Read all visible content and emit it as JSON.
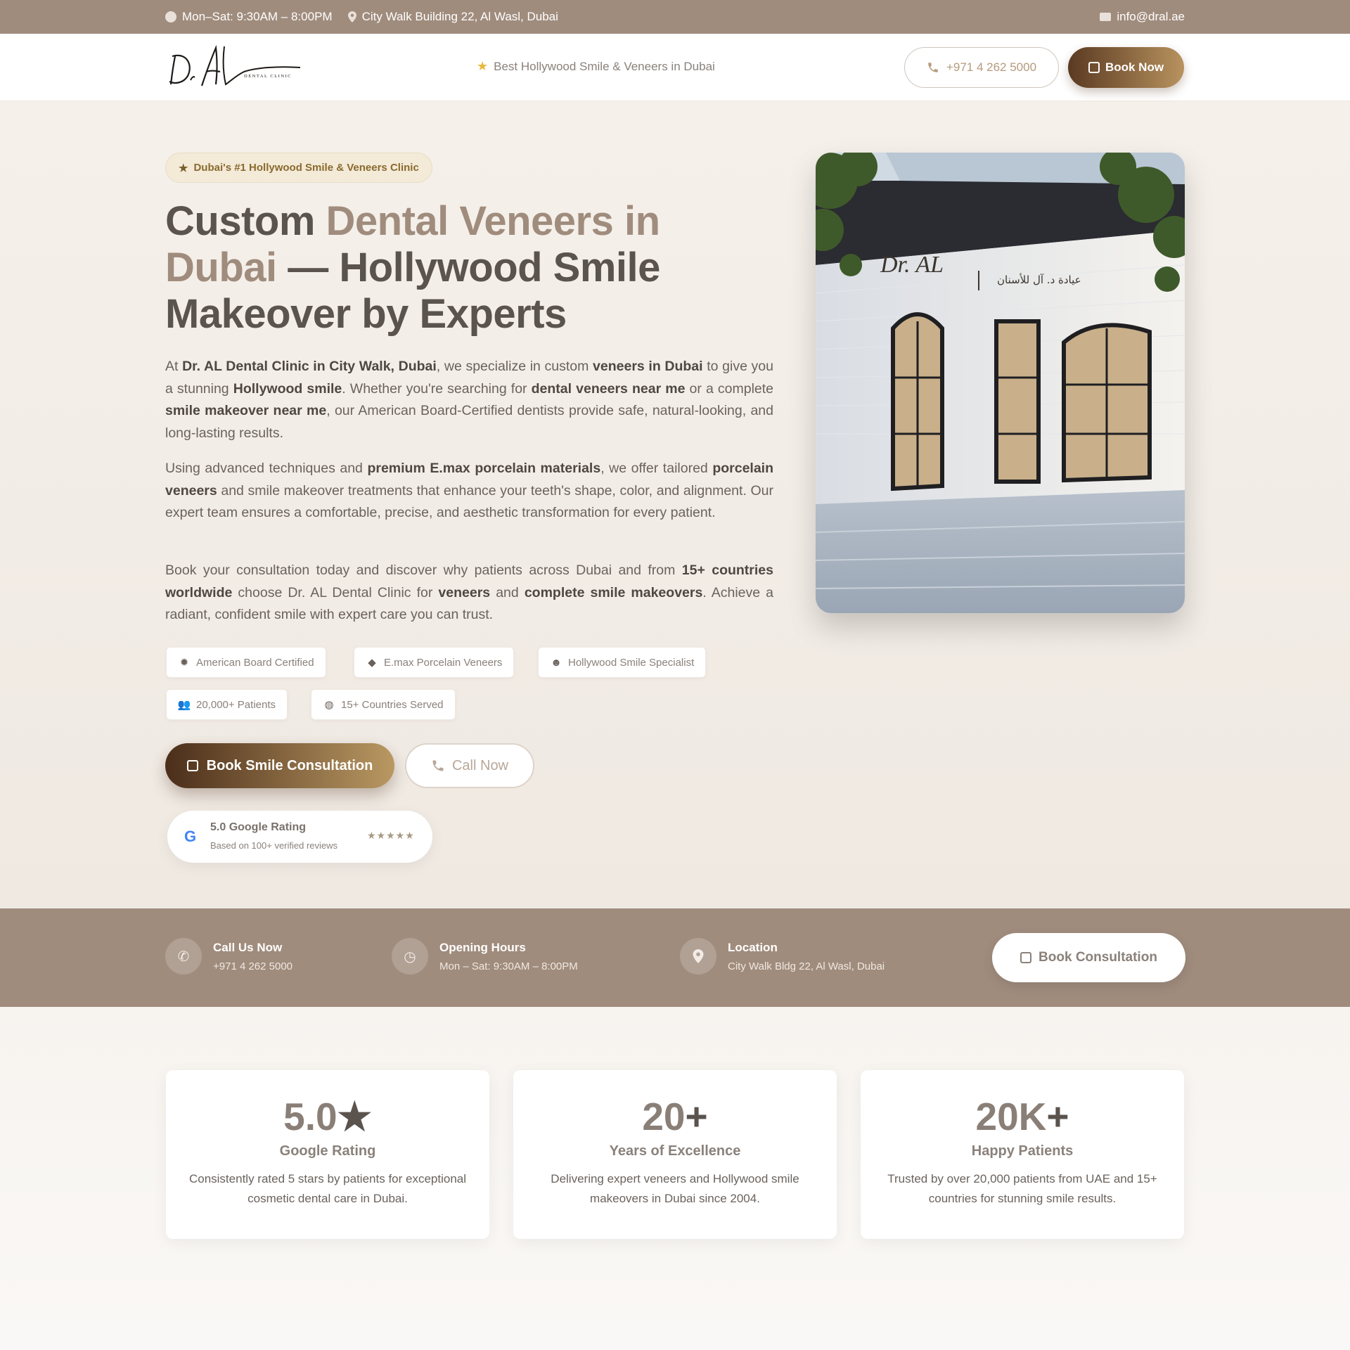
{
  "topbar": {
    "hours": "Mon–Sat: 9:30AM – 8:00PM",
    "address": "City Walk Building 22, Al Wasl, Dubai",
    "email": "info@dral.ae"
  },
  "header": {
    "logo_text": "Dr. AL",
    "logo_sub": "DENTAL CLINIC",
    "tagline": "Best Hollywood Smile & Veneers in Dubai",
    "phone": "+971 4 262 5000",
    "book_label": "Book Now"
  },
  "hero": {
    "badge": "Dubai's #1 Hollywood Smile & Veneers Clinic",
    "title_part1": "Custom ",
    "title_accent1": "Dental Veneers in Dubai",
    "title_part2": " — Hollywood Smile Makeover by Experts",
    "paragraphs": [
      [
        {
          "t": "At "
        },
        {
          "t": "Dr. AL Dental Clinic in City Walk, Dubai",
          "b": true
        },
        {
          "t": ", we specialize in custom "
        },
        {
          "t": "veneers in Dubai",
          "b": true
        },
        {
          "t": " to give you a stunning "
        },
        {
          "t": "Hollywood smile",
          "b": true
        },
        {
          "t": ". Whether you're searching for "
        },
        {
          "t": "dental veneers near me",
          "b": true
        },
        {
          "t": " or a complete "
        },
        {
          "t": "smile makeover near me",
          "b": true
        },
        {
          "t": ", our American Board-Certified dentists provide safe, natural-looking, and long-lasting results."
        }
      ],
      [
        {
          "t": "Using advanced techniques and "
        },
        {
          "t": "premium E.max porcelain materials",
          "b": true
        },
        {
          "t": ", we offer tailored "
        },
        {
          "t": "porcelain veneers",
          "b": true
        },
        {
          "t": " and smile makeover treatments that enhance your teeth's shape, color, and alignment. Our expert team ensures a comfortable, precise, and aesthetic transformation for every patient."
        }
      ],
      [
        {
          "t": "Book your consultation today and discover why patients across Dubai and from "
        },
        {
          "t": "15+ countries worldwide",
          "b": true
        },
        {
          "t": " choose Dr. AL Dental Clinic for "
        },
        {
          "t": "veneers",
          "b": true
        },
        {
          "t": " and "
        },
        {
          "t": "complete smile makeovers",
          "b": true
        },
        {
          "t": ". Achieve a radiant, confident smile with expert care you can trust."
        }
      ]
    ],
    "chips": [
      {
        "label": "American Board Certified",
        "icon": "certificate-icon"
      },
      {
        "label": "E.max Porcelain Veneers",
        "icon": "gem-icon"
      },
      {
        "label": "Hollywood Smile Specialist",
        "icon": "smile-icon"
      },
      {
        "label": "20,000+ Patients",
        "icon": "users-icon"
      },
      {
        "label": "15+ Countries Served",
        "icon": "globe-icon"
      }
    ],
    "cta_primary": "Book Smile Consultation",
    "cta_secondary": "Call Now",
    "rating_title": "5.0 Google Rating",
    "rating_sub": "Based on 100+ verified reviews",
    "rating_stars": "★★★★★",
    "storefront_sign": "Dr. AL",
    "storefront_sign_ar": "عيادة د. آل للأسنان"
  },
  "infobar": {
    "call_title": "Call Us Now",
    "call_value": "+971 4 262 5000",
    "hours_title": "Opening Hours",
    "hours_value": "Mon – Sat: 9:30AM – 8:00PM",
    "location_title": "Location",
    "location_value": "City Walk Bldg 22, Al Wasl, Dubai",
    "book_label": "Book Consultation"
  },
  "stats": [
    {
      "num": "5.0",
      "suffix": "★",
      "label": "Google Rating",
      "desc": "Consistently rated 5 stars by patients for exceptional cosmetic dental care in Dubai."
    },
    {
      "num": "20",
      "suffix": "+",
      "label": "Years of Excellence",
      "desc": "Delivering expert veneers and Hollywood smile makeovers in Dubai since 2004."
    },
    {
      "num": "20K",
      "suffix": "+",
      "label": "Happy Patients",
      "desc": "Trusted by over 20,000 patients from UAE and 15+ countries for stunning smile results."
    }
  ],
  "colors": {
    "brand": "#a08c7d",
    "dark_text": "#5b534e",
    "gold_gradient_start": "#4b2e1a",
    "gold_gradient_end": "#b99862"
  }
}
